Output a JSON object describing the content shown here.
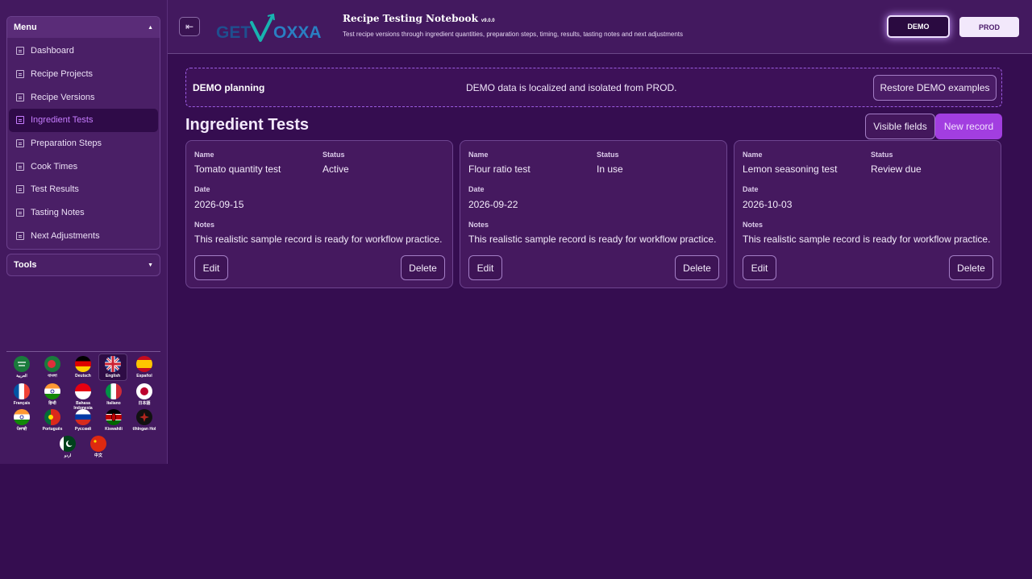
{
  "sidebar": {
    "menu_title": "Menu",
    "tools_title": "Tools",
    "items": [
      {
        "label": "Dashboard"
      },
      {
        "label": "Recipe Projects"
      },
      {
        "label": "Recipe Versions"
      },
      {
        "label": "Ingredient Tests"
      },
      {
        "label": "Preparation Steps"
      },
      {
        "label": "Cook Times"
      },
      {
        "label": "Test Results"
      },
      {
        "label": "Tasting Notes"
      },
      {
        "label": "Next Adjustments"
      }
    ],
    "active_item": "Ingredient Tests",
    "languages": [
      {
        "label": "العربية"
      },
      {
        "label": "বাংলা"
      },
      {
        "label": "Deutsch"
      },
      {
        "label": "English"
      },
      {
        "label": "Español"
      },
      {
        "label": "Français"
      },
      {
        "label": "हिन्दी"
      },
      {
        "label": "Bahasa Indonesia"
      },
      {
        "label": "Italiano"
      },
      {
        "label": "日本語"
      },
      {
        "label": "ਪੰਜਾਬੀ"
      },
      {
        "label": "Português"
      },
      {
        "label": "Русский"
      },
      {
        "label": "Kiswahili"
      },
      {
        "label": "tlhIngan Hol"
      },
      {
        "label": "اردو"
      },
      {
        "label": "中文"
      }
    ],
    "selected_language": "English"
  },
  "header": {
    "logo_text_left": "GET",
    "logo_text_right": "OXXA",
    "title": "Recipe Testing Notebook",
    "version": "v9.0.0",
    "subtitle": "Test recipe versions through ingredient quantities, preparation steps, timing, results, tasting notes and next adjustments",
    "demo_label": "DEMO",
    "prod_label": "PROD"
  },
  "banner": {
    "title": "DEMO planning",
    "message": "DEMO data is localized and isolated from PROD.",
    "restore_label": "Restore DEMO examples"
  },
  "main": {
    "title": "Ingredient Tests",
    "visible_fields_label": "Visible fields",
    "new_record_label": "New record",
    "field_labels": {
      "name": "Name",
      "status": "Status",
      "date": "Date",
      "notes": "Notes"
    },
    "edit_label": "Edit",
    "delete_label": "Delete",
    "records": [
      {
        "name": "Tomato quantity test",
        "status": "Active",
        "date": "2026-09-15",
        "notes": "This realistic sample record is ready for workflow practice."
      },
      {
        "name": "Flour ratio test",
        "status": "In use",
        "date": "2026-09-22",
        "notes": "This realistic sample record is ready for workflow practice."
      },
      {
        "name": "Lemon seasoning test",
        "status": "Review due",
        "date": "2026-10-03",
        "notes": "This realistic sample record is ready for workflow practice."
      }
    ]
  },
  "colors": {
    "background": "#350d50",
    "accent": "#a23ee0",
    "active_menu_text": "#c77dff"
  }
}
